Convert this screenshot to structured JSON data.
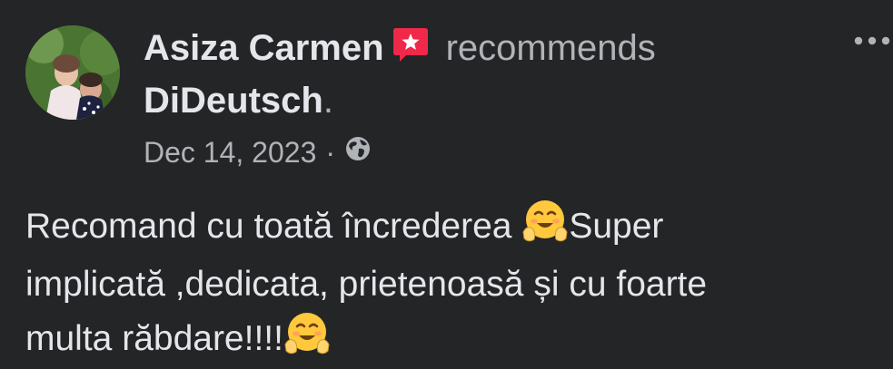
{
  "post": {
    "author": "Asiza Carmen",
    "action": "recommends",
    "page": "DiDeutsch",
    "period": ".",
    "date": "Dec 14, 2023",
    "separator": "·",
    "body": {
      "part1": "Recomand cu toată încrederea ",
      "part2": "Super",
      "line2": "implicată ,dedicata, prietenoasă și cu foarte",
      "line3": "multa răbdare!!!!"
    }
  },
  "icons": {
    "badge": "recommendation-star-icon",
    "more": "more-options-icon",
    "privacy": "globe-icon",
    "emoji": "hugging-face-emoji"
  },
  "colors": {
    "background": "#242526",
    "primary_text": "#e4e6eb",
    "secondary_text": "#b0b3b8",
    "badge": "#f02849"
  }
}
